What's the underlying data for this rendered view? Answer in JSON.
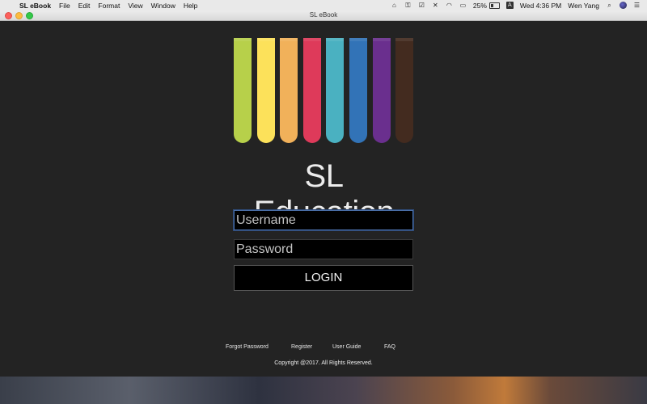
{
  "menubar": {
    "app_name": "SL eBook",
    "menus": [
      "File",
      "Edit",
      "Format",
      "View",
      "Window",
      "Help"
    ],
    "battery": "25%",
    "clock": "Wed 4:36 PM",
    "user": "Wen Yang",
    "input_letter": "A"
  },
  "window": {
    "title": "SL eBook"
  },
  "logo": {
    "brand": "SL Education",
    "book_colors": [
      "#b7d04a",
      "#fce15a",
      "#f1b15a",
      "#de3a5a",
      "#4ab1c1",
      "#3273b7",
      "#6a2f8e",
      "#432b1f"
    ]
  },
  "login": {
    "username_placeholder": "Username",
    "password_placeholder": "Password",
    "login_label": "LOGIN"
  },
  "footer": {
    "links": [
      "Forgot Password",
      "Register",
      "User Guide",
      "FAQ"
    ],
    "copyright": "Copyright @2017. All Rights Reserved."
  }
}
